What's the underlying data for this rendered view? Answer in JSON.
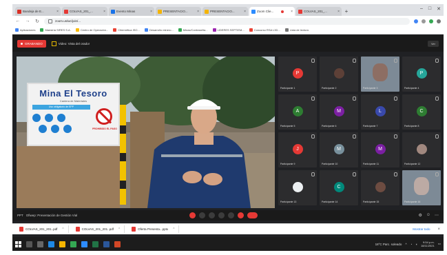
{
  "browser": {
    "tabs": [
      {
        "label": "Bandeja de E...",
        "color": "#d93025",
        "active": false
      },
      {
        "label": "COLVAS_201_...",
        "color": "#e53935",
        "active": false
      },
      {
        "label": "Evento Minas",
        "color": "#1a73e8",
        "active": false
      },
      {
        "label": "PRESENTACIO...",
        "color": "#f4b400",
        "active": false
      },
      {
        "label": "PRESENTACIO...",
        "color": "#f4b400",
        "active": false
      },
      {
        "label": "Zoom Clie...",
        "color": "#2d8cff",
        "active": true,
        "recording": true
      },
      {
        "label": "COLVAS_201_...",
        "color": "#e53935",
        "active": false
      }
    ],
    "new_tab": "+",
    "address": "zoom.us/wc/join/...",
    "window_controls": [
      "–",
      "□",
      "✕"
    ],
    "bookmarks": [
      {
        "label": "Aplicaciones",
        "color": "#4285f4"
      },
      {
        "label": "Maestría SIRES S.A.",
        "color": "#34a853"
      },
      {
        "label": "Centro de Operación...",
        "color": "#fbbc05"
      },
      {
        "label": "Cibernética ISO...",
        "color": "#ea4335"
      },
      {
        "label": "Desarrollo minero...",
        "color": "#4285f4"
      },
      {
        "label": "Minas/Contraseña...",
        "color": "#34a853"
      },
      {
        "label": "LIDERES SEPTIEM...",
        "color": "#9c27b0"
      },
      {
        "label": "Concurso RSA L3D...",
        "color": "#ea4335"
      },
      {
        "label": "Lista de lectura",
        "color": "#777777"
      }
    ]
  },
  "zoom": {
    "recording_label": "GRABANDO",
    "topbar_info": "Video: Vista del orador",
    "view_button": "Ver",
    "stage": {
      "sign_title": "Mina El Tesoro",
      "sign_subtitle": "Cantera de Materiales",
      "sign_bar": "Uso obligatorio de EPP",
      "prohibited": "PROHIBIDO EL PASO"
    },
    "participants": [
      {
        "name": "Participante 1",
        "initial": "P",
        "color": "#e53935"
      },
      {
        "name": "Participante 2",
        "initial": "",
        "color": "#5d4037"
      },
      {
        "name": "Participante 3",
        "initial": "",
        "color": "#8d6e63",
        "video": true
      },
      {
        "name": "Participante 4",
        "initial": "P",
        "color": "#26a69a"
      },
      {
        "name": "Participante 5",
        "initial": "A",
        "color": "#2e7d32"
      },
      {
        "name": "Participante 6",
        "initial": "M",
        "color": "#7b1fa2"
      },
      {
        "name": "Participante 7",
        "initial": "L",
        "color": "#3949ab"
      },
      {
        "name": "Participante 8",
        "initial": "C",
        "color": "#2e7d32"
      },
      {
        "name": "Participante 9",
        "initial": "J",
        "color": "#e53935"
      },
      {
        "name": "Participante 10",
        "initial": "M",
        "color": "#78909c"
      },
      {
        "name": "Participante 11",
        "initial": "M",
        "color": "#7b1fa2"
      },
      {
        "name": "Participante 12",
        "initial": "",
        "color": "#a1887f"
      },
      {
        "name": "Participante 13",
        "initial": "",
        "color": "#eceff1"
      },
      {
        "name": "Participante 14",
        "initial": "C",
        "color": "#00897b"
      },
      {
        "name": "Participante 15",
        "initial": "",
        "color": "#6d4c41"
      },
      {
        "name": "Participante 16",
        "initial": "",
        "color": "#bcaaa4",
        "video": true
      }
    ],
    "toolbar_title": "Ofiwep: Presentación de Gestión Vial",
    "toolbar_prefix": "PPT"
  },
  "downloads": [
    {
      "label": "COLVAS_201_201..pdf"
    },
    {
      "label": "COLVAS_201_201..pdf"
    },
    {
      "label": "Oferta Presenta...pptx"
    }
  ],
  "downloads_show_all": "Mostrar todo",
  "taskbar": {
    "weather": "18°C  Parc. soleado",
    "time": "9:54 p.m.",
    "date": "18/11/2021"
  }
}
